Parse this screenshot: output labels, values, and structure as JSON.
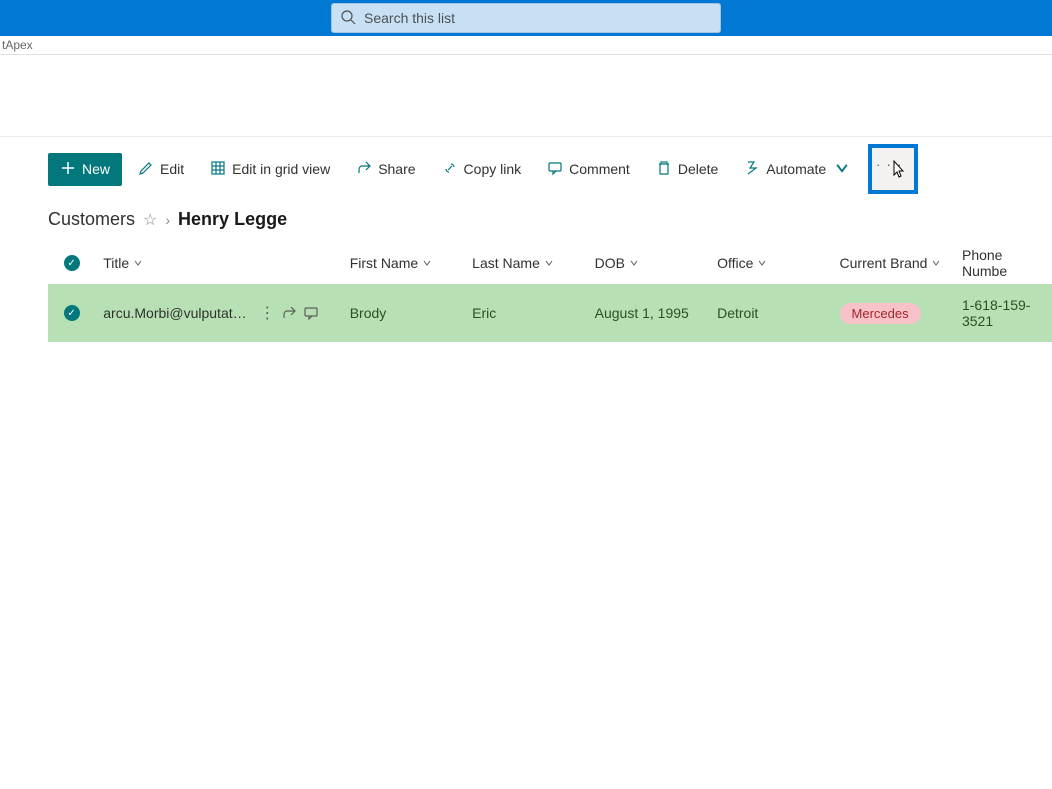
{
  "app_label": "tApex",
  "search": {
    "placeholder": "Search this list"
  },
  "commands": {
    "new": "New",
    "edit": "Edit",
    "edit_grid": "Edit in grid view",
    "share": "Share",
    "copy_link": "Copy link",
    "comment": "Comment",
    "delete": "Delete",
    "automate": "Automate"
  },
  "breadcrumb": {
    "list": "Customers",
    "item": "Henry Legge"
  },
  "columns": {
    "title": "Title",
    "first_name": "First Name",
    "last_name": "Last Name",
    "dob": "DOB",
    "office": "Office",
    "current_brand": "Current Brand",
    "phone": "Phone Numbe"
  },
  "rows": [
    {
      "title": "arcu.Morbi@vulputatedu...",
      "first_name": "Brody",
      "last_name": "Eric",
      "dob": "August 1, 1995",
      "office": "Detroit",
      "current_brand": "Mercedes",
      "phone": "1-618-159-3521"
    }
  ]
}
